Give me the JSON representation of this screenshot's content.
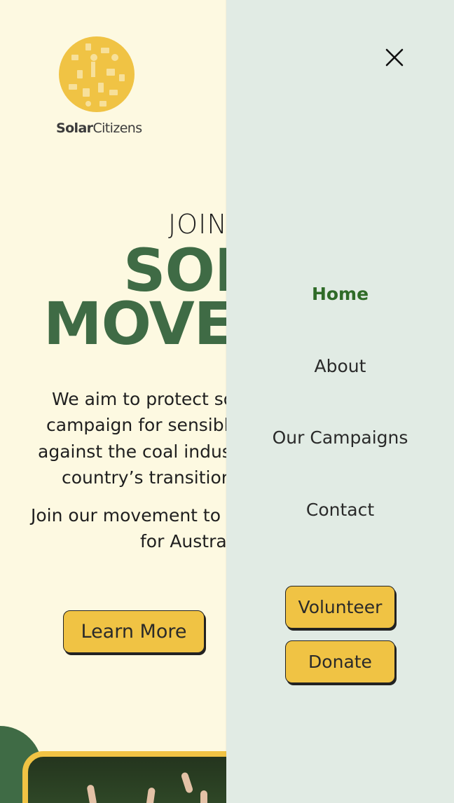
{
  "logo": {
    "text_bold": "Solar",
    "text_regular": "Citizens",
    "icon": "solar-collage-logo-icon"
  },
  "hero": {
    "kicker": "JOIN",
    "headline_line1": "SOL",
    "headline_line2": "MOVE",
    "paragraph1_lines": [
      "We aim to protect so",
      "campaign for sensible",
      "against the coal industr",
      "country’s transition to"
    ],
    "paragraph2_lines": [
      "Join our movement to cr",
      "for Australi"
    ],
    "cta_label": "Learn More"
  },
  "drawer": {
    "close_icon": "close-icon",
    "nav": [
      {
        "label": "Home",
        "active": true
      },
      {
        "label": "About",
        "active": false
      },
      {
        "label": "Our Campaigns",
        "active": false
      },
      {
        "label": "Contact",
        "active": false
      }
    ],
    "volunteer_label": "Volunteer",
    "donate_label": "Donate"
  },
  "colors": {
    "background": "#fdf9e1",
    "drawer_background": "#e1ebe4",
    "brand_green": "#3f6b45",
    "active_nav": "#2f6b28",
    "button_yellow": "#f0c344"
  }
}
